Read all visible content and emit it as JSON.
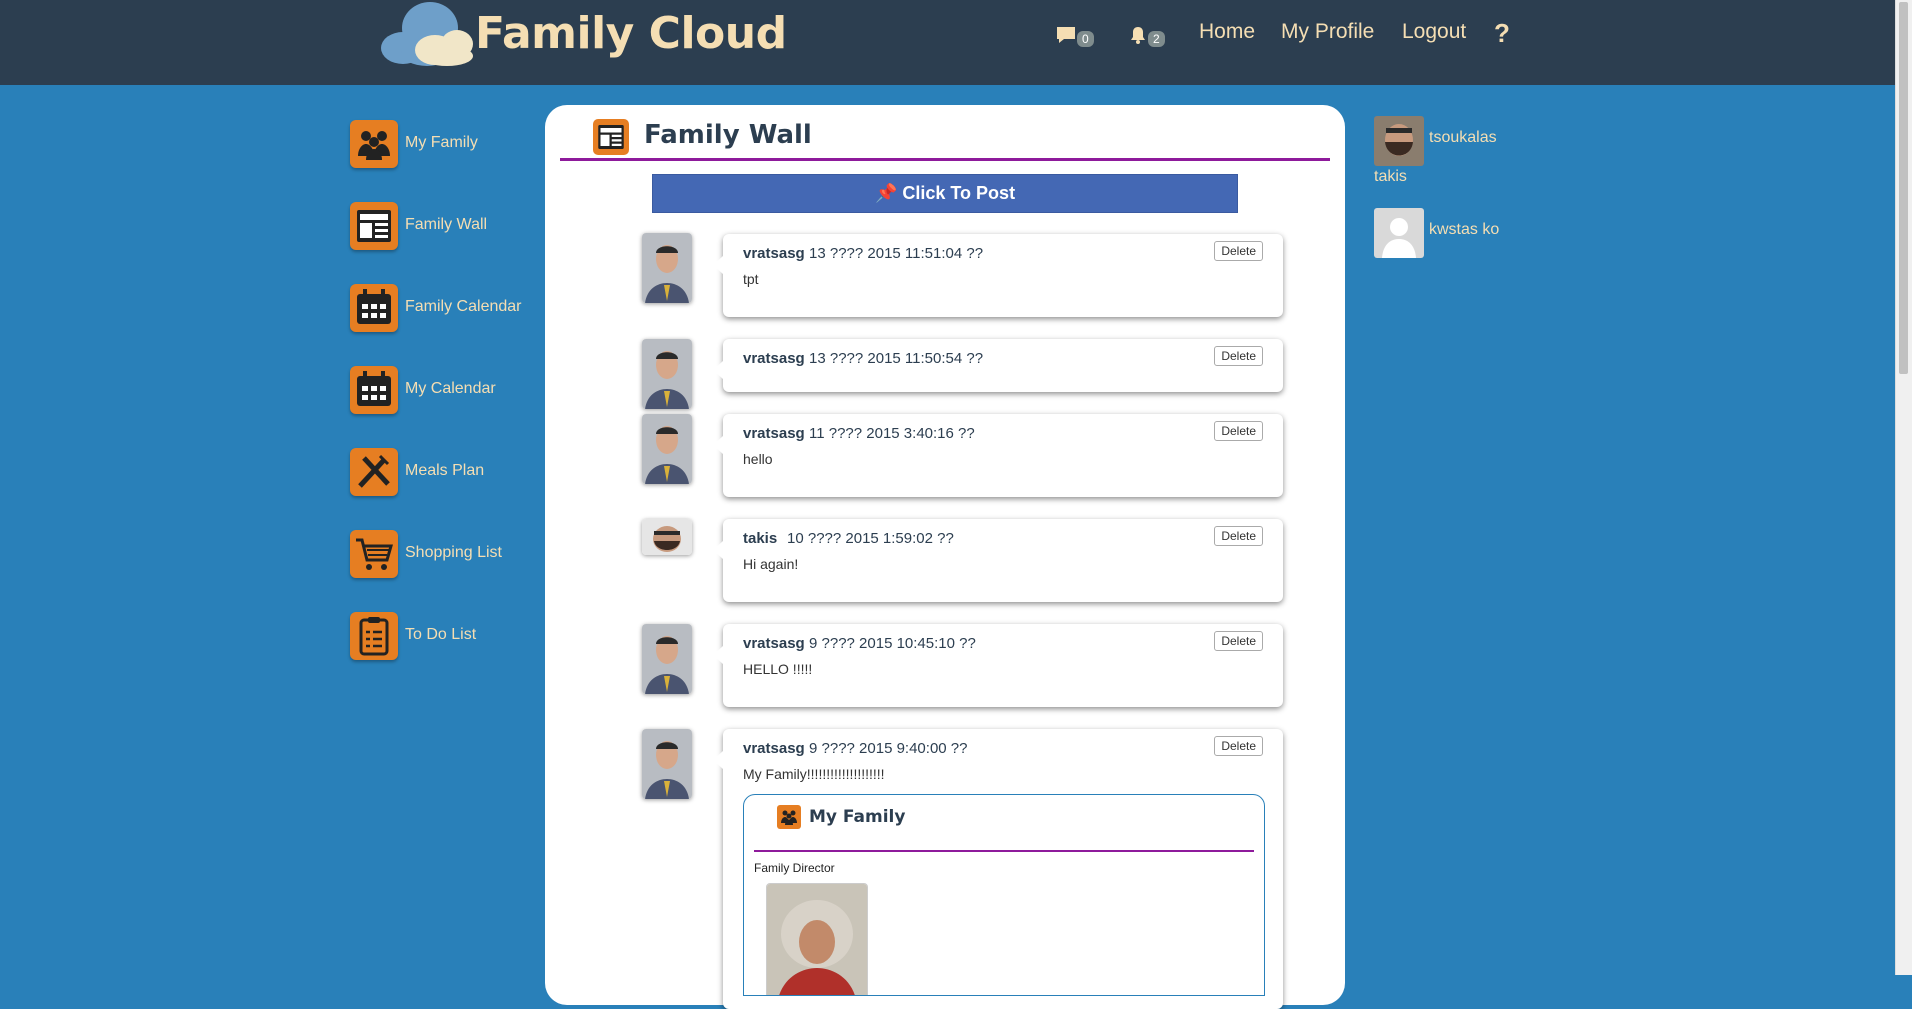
{
  "header": {
    "app_title": "Family Cloud",
    "messages_count": "0",
    "notifications_count": "2",
    "nav": [
      "Home",
      "My Profile",
      "Logout"
    ],
    "help": "?"
  },
  "sidebar": {
    "items": [
      {
        "label": "My Family",
        "icon": "family-icon"
      },
      {
        "label": "Family Wall",
        "icon": "wall-icon"
      },
      {
        "label": "Family Calendar",
        "icon": "calendar-icon"
      },
      {
        "label": "My Calendar",
        "icon": "calendar-icon"
      },
      {
        "label": "Meals Plan",
        "icon": "fork-knife-icon"
      },
      {
        "label": "Shopping List",
        "icon": "cart-icon"
      },
      {
        "label": "To Do List",
        "icon": "checklist-icon"
      }
    ]
  },
  "wall": {
    "title": "Family Wall",
    "post_button": "Click To Post",
    "delete_label": "Delete",
    "posts": [
      {
        "user": "vratsasg",
        "date": "13 ???? 2015 11:51:04 ??",
        "text": "tpt"
      },
      {
        "user": "vratsasg",
        "date": "13 ???? 2015 11:50:54 ??",
        "text": ""
      },
      {
        "user": "vratsasg",
        "date": "11 ???? 2015 3:40:16 ??",
        "text": "hello"
      },
      {
        "user": "takis",
        "date": "10 ???? 2015 1:59:02 ??",
        "text": "Hi again!"
      },
      {
        "user": "vratsasg",
        "date": "9 ???? 2015 10:45:10 ??",
        "text": "HELLO !!!!!"
      },
      {
        "user": "vratsasg",
        "date": "9 ???? 2015 9:40:00 ??",
        "text": "My Family!!!!!!!!!!!!!!!!!!!!"
      }
    ],
    "embed": {
      "title": "My Family",
      "subtitle": "Family Director"
    }
  },
  "members": [
    {
      "first": "tsoukalas",
      "second": "takis"
    },
    {
      "first": "kwstas ko",
      "second": ""
    }
  ],
  "colors": {
    "topbar": "#2c3e50",
    "background": "#2980b9",
    "accent_text": "#f5deb3",
    "icon_orange": "#e67e22",
    "rule_purple": "#8e1a9b",
    "post_button": "#4468b4"
  }
}
